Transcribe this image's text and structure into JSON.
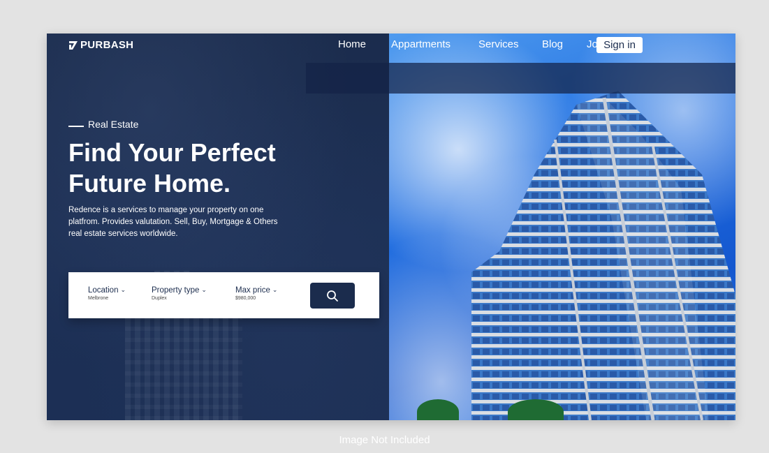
{
  "brand": {
    "name": "PURBASH"
  },
  "nav": {
    "items": [
      {
        "label": "Home"
      },
      {
        "label": "Appartments"
      },
      {
        "label": "Services"
      },
      {
        "label": "Blog"
      },
      {
        "label": "Join us"
      }
    ],
    "signin_label": "Sign in"
  },
  "hero": {
    "kicker": "Real Estate",
    "title_line1": "Find Your Perfect",
    "title_line2": "Future Home.",
    "description": "Redence is a services to manage your property on one platfrom. Provides valutation. Sell, Buy, Mortgage & Others real estate services worldwide."
  },
  "search": {
    "filters": [
      {
        "label": "Location",
        "value": "Melbrone"
      },
      {
        "label": "Property type",
        "value": "Duplex"
      },
      {
        "label": "Max price",
        "value": "$980,000"
      }
    ],
    "button_icon": "search-icon"
  },
  "caption": "Image Not Included",
  "colors": {
    "navy": "#1b2c4d",
    "sky": "#1f6de0",
    "white": "#ffffff"
  }
}
